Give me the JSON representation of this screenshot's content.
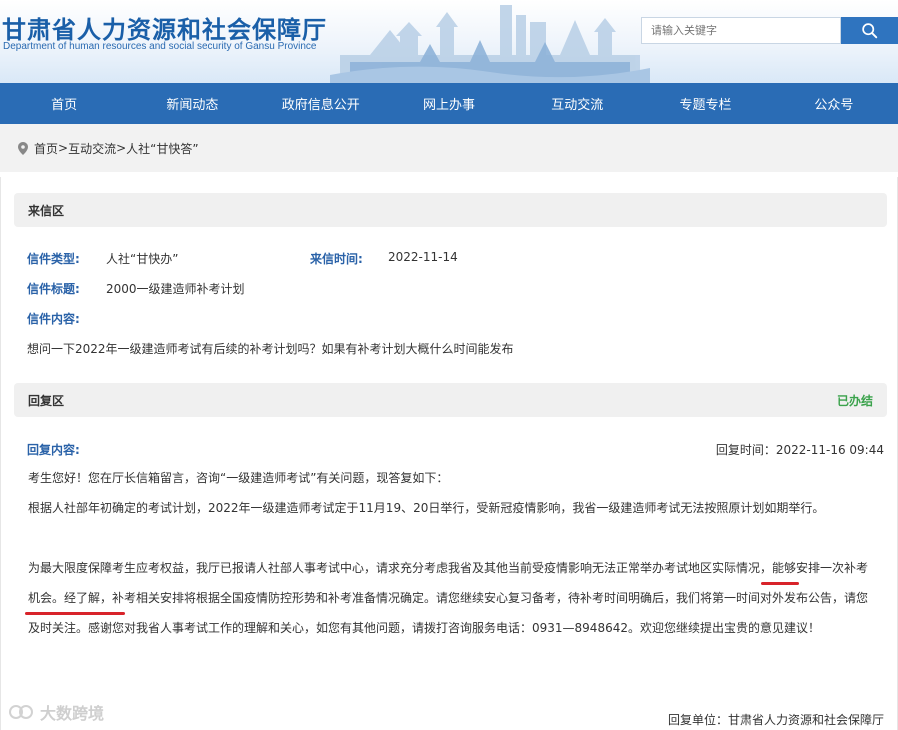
{
  "header": {
    "title": "甘肃省人力资源和社会保障厅",
    "subtitle": "Department of human resources and social security of Gansu Province",
    "search_placeholder": "请输入关键字",
    "search_icon": "search-icon"
  },
  "nav": {
    "items": [
      "首页",
      "新闻动态",
      "政府信息公开",
      "网上办事",
      "互动交流",
      "专题专栏",
      "公众号"
    ]
  },
  "breadcrumb": {
    "home": "首页",
    "sep1": ">",
    "section": "互动交流",
    "sep2": ">",
    "current": "人社“甘快答”"
  },
  "letter": {
    "section_title": "来信区",
    "type_label": "信件类型:",
    "type_value": "人社“甘快办”",
    "time_label": "来信时间:",
    "time_value": "2022-11-14",
    "subject_label": "信件标题:",
    "subject_value": "2000一级建造师补考计划",
    "content_label": "信件内容:",
    "content_value": "想问一下2022年一级建造师考试有后续的补考计划吗？如果有补考计划大概什么时间能发布"
  },
  "reply": {
    "section_title": "回复区",
    "status": "已办结",
    "content_label": "回复内容:",
    "time": "回复时间：2022-11-16 09:44",
    "p1": "考生您好！您在厅长信箱留言，咨询“一级建造师考试”有关问题，现答复如下：",
    "p2": "根据人社部年初确定的考试计划，2022年一级建造师考试定于11月19、20日举行，受新冠疫情影响，我省一级建造师考试无法按照原计划如期举行。",
    "p3": "为最大限度保障考生应考权益，我厅已报请人社部人事考试中心，请求充分考虑我省及其他当前受疫情影响无法正常举办考试地区实际情况，能够安排一次补考机会。经了解，补考相关安排将根据全国疫情防控形势和补考准备情况确定。请您继续安心复习备考，待补考时间明确后，我们将第一时间对外发布公告，请您及时关注。感谢您对我省人事考试工作的理解和关心，如您有其他问题，请拨打咨询服务电话：0931—8948642。欢迎您继续提出宝贵的意见建议！",
    "unit": "回复单位：甘肃省人力资源和社会保障厅"
  },
  "watermark": "大数跨境",
  "colors": {
    "brand": "#1a5fa8",
    "nav_bg": "#2a6cb5",
    "label": "#2a62a8",
    "status": "#3aa24b",
    "underline": "#d8232a"
  }
}
